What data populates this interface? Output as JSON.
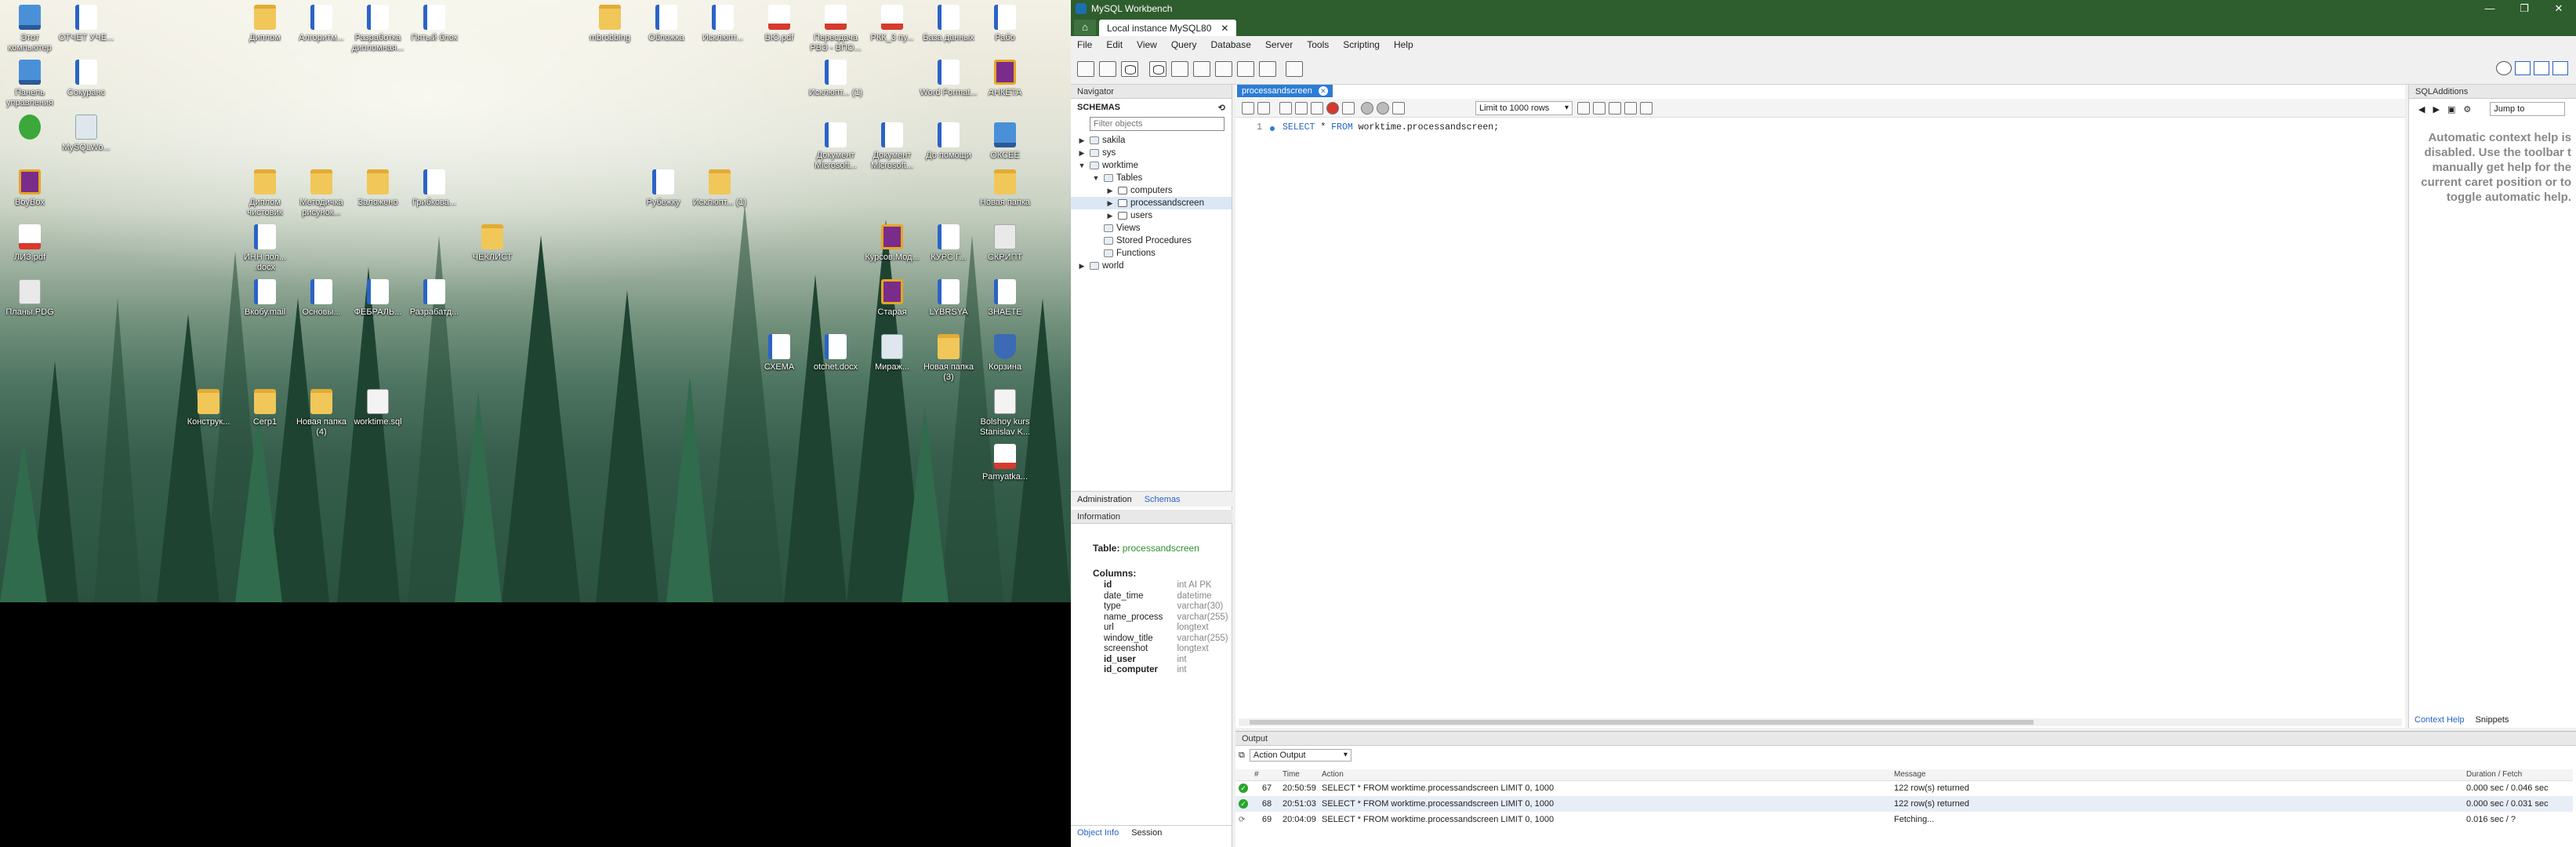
{
  "desktop": {
    "icons": [
      {
        "label": "Этот компьютер",
        "kind": "pc"
      },
      {
        "label": "ОТЧЕТ УЧЕ...",
        "kind": "doc"
      },
      {
        "label": "Диплом",
        "kind": "folder"
      },
      {
        "label": "Алгоритм...",
        "kind": "doc"
      },
      {
        "label": "Разработка дипломная...",
        "kind": "doc"
      },
      {
        "label": "Пятый блок",
        "kind": "doc"
      },
      {
        "label": "mbrobbing",
        "kind": "folder"
      },
      {
        "label": "Обложка",
        "kind": "doc"
      },
      {
        "label": "Исклюпт...",
        "kind": "doc"
      },
      {
        "label": "БЮ.pdf",
        "kind": "pdf"
      },
      {
        "label": "Пересдача РВЭ - ВПО...",
        "kind": "pdf"
      },
      {
        "label": "РКК_3 пу...",
        "kind": "pdf"
      },
      {
        "label": "База данных",
        "kind": "doc"
      },
      {
        "label": "Рабо",
        "kind": "doc"
      },
      {
        "label": "Панель управления",
        "kind": "pc"
      },
      {
        "label": "Сокуранс",
        "kind": "doc"
      },
      {
        "label": "Исклюпт... (1)",
        "kind": "doc"
      },
      {
        "label": "Word Format...",
        "kind": "doc"
      },
      {
        "label": "АНКЕТА",
        "kind": "rar"
      },
      {
        "label": "",
        "kind": "app"
      },
      {
        "label": "MySQLWo...",
        "kind": "bin"
      },
      {
        "label": "Документ Microsoft...",
        "kind": "doc"
      },
      {
        "label": "Документ Microsoft...",
        "kind": "doc"
      },
      {
        "label": "До помощи",
        "kind": "doc"
      },
      {
        "label": "ОКСЕЕ",
        "kind": "pc"
      },
      {
        "label": "BoyBox",
        "kind": "rar"
      },
      {
        "label": "Диплом чистовик",
        "kind": "folder"
      },
      {
        "label": "Методичка рисунок...",
        "kind": "folder"
      },
      {
        "label": "Заложено",
        "kind": "folder"
      },
      {
        "label": "Грибкова...",
        "kind": "doc"
      },
      {
        "label": "Рубежку",
        "kind": "doc"
      },
      {
        "label": "Исклюпт... (1)",
        "kind": "folder"
      },
      {
        "label": "Новая папка",
        "kind": "folder"
      },
      {
        "label": "ЛИЗ.pdf",
        "kind": "pdf"
      },
      {
        "label": "ИНН пол... .docx",
        "kind": "doc"
      },
      {
        "label": "ЧЕКЛИСТ",
        "kind": "folder"
      },
      {
        "label": "Курсов.Мод...",
        "kind": "rar"
      },
      {
        "label": "КУРС Г...",
        "kind": "doc"
      },
      {
        "label": "СКРИПТ",
        "kind": "blank"
      },
      {
        "label": "Планы.PDG",
        "kind": "blank"
      },
      {
        "label": "Вкобу.mail",
        "kind": "doc"
      },
      {
        "label": "Основы...",
        "kind": "doc"
      },
      {
        "label": "ФЕБРАЛЬ...",
        "kind": "doc"
      },
      {
        "label": "Разрабатд...",
        "kind": "doc"
      },
      {
        "label": "Старая",
        "kind": "rar"
      },
      {
        "label": "LYBRSYA",
        "kind": "doc"
      },
      {
        "label": "ЗНАЕТЕ",
        "kind": "doc"
      },
      {
        "label": "СХЕМА",
        "kind": "doc"
      },
      {
        "label": "otchet.docx",
        "kind": "doc"
      },
      {
        "label": "Мираж...",
        "kind": "bin"
      },
      {
        "label": "Новая папка (3)",
        "kind": "folder"
      },
      {
        "label": "Корзина",
        "kind": "shield"
      },
      {
        "label": "Конструк...",
        "kind": "folder"
      },
      {
        "label": "Сегр1",
        "kind": "folder"
      },
      {
        "label": "Новая папка (4)",
        "kind": "folder"
      },
      {
        "label": "worktime.sql",
        "kind": "txt"
      },
      {
        "label": "Bolshoy kurs Stanislav K...",
        "kind": "txt"
      },
      {
        "label": "Pamyatka...",
        "kind": "pdf"
      }
    ]
  },
  "wb": {
    "title": "MySQL Workbench",
    "winbtns": [
      "—",
      "❐",
      "✕"
    ],
    "home_icon": "home-icon",
    "conn_tab": "Local instance MySQL80",
    "conn_close": "✕",
    "menu": [
      "File",
      "Edit",
      "View",
      "Query",
      "Database",
      "Server",
      "Tools",
      "Scripting",
      "Help"
    ],
    "navigator": {
      "header": "Navigator",
      "schemas": "SCHEMAS",
      "filter_placeholder": "Filter objects",
      "tree": [
        {
          "label": "sakila",
          "depth": 0,
          "arrow": "▶",
          "icon": "db"
        },
        {
          "label": "sys",
          "depth": 0,
          "arrow": "▶",
          "icon": "db"
        },
        {
          "label": "worktime",
          "depth": 0,
          "arrow": "▼",
          "icon": "db"
        },
        {
          "label": "Tables",
          "depth": 1,
          "arrow": "▼",
          "icon": "db"
        },
        {
          "label": "computers",
          "depth": 2,
          "arrow": "▶",
          "icon": "tbl"
        },
        {
          "label": "processandscreen",
          "depth": 2,
          "arrow": "▶",
          "icon": "tbl",
          "selected": true
        },
        {
          "label": "users",
          "depth": 2,
          "arrow": "▶",
          "icon": "tbl"
        },
        {
          "label": "Views",
          "depth": 1,
          "arrow": "",
          "icon": "db"
        },
        {
          "label": "Stored Procedures",
          "depth": 1,
          "arrow": "",
          "icon": "db"
        },
        {
          "label": "Functions",
          "depth": 1,
          "arrow": "",
          "icon": "db"
        },
        {
          "label": "world",
          "depth": 0,
          "arrow": "▶",
          "icon": "db"
        }
      ],
      "tab_admin": "Administration",
      "tab_schemas": "Schemas",
      "info_header": "Information",
      "table_label": "Table:",
      "table_name": "processandscreen",
      "columns_label": "Columns:",
      "columns": [
        {
          "name": "id",
          "type": "int AI PK",
          "bold": true
        },
        {
          "name": "date_time",
          "type": "datetime",
          "bold": false
        },
        {
          "name": "type",
          "type": "varchar(30)",
          "bold": false
        },
        {
          "name": "name_process",
          "type": "varchar(255)",
          "bold": false
        },
        {
          "name": "url",
          "type": "longtext",
          "bold": false
        },
        {
          "name": "window_title",
          "type": "varchar(255)",
          "bold": false
        },
        {
          "name": "screenshot",
          "type": "longtext",
          "bold": false
        },
        {
          "name": "id_user",
          "type": "int",
          "bold": true
        },
        {
          "name": "id_computer",
          "type": "int",
          "bold": true
        }
      ],
      "tab_objinfo": "Object Info",
      "tab_session": "Session"
    },
    "editor": {
      "tab": "processandscreen",
      "limit": "Limit to 1000 rows",
      "line_no": "1",
      "sql_kw1": "SELECT",
      "sql_star": " * ",
      "sql_kw2": "FROM",
      "sql_rest": " worktime.processandscreen;"
    },
    "additions": {
      "header": "SQLAdditions",
      "jump": "Jump to",
      "help": "Automatic context help is disabled. Use the toolbar t manually get help for the current caret position or to toggle automatic help.",
      "tab_context": "Context Help",
      "tab_snippets": "Snippets"
    },
    "output": {
      "header": "Output",
      "selector": "Action Output",
      "cols": [
        "#",
        "Time",
        "Action",
        "Message",
        "Duration / Fetch"
      ],
      "rows": [
        {
          "status": "ok",
          "n": "67",
          "time": "20:50:59",
          "action": "SELECT * FROM worktime.processandscreen LIMIT 0, 1000",
          "message": "122 row(s) returned",
          "duration": "0.000 sec / 0.046 sec"
        },
        {
          "status": "ok",
          "n": "68",
          "time": "20:51:03",
          "action": "SELECT * FROM worktime.processandscreen LIMIT 0, 1000",
          "message": "122 row(s) returned",
          "duration": "0.000 sec / 0.031 sec"
        },
        {
          "status": "pending",
          "n": "69",
          "time": "20:04:09",
          "action": "SELECT * FROM worktime.processandscreen LIMIT 0, 1000",
          "message": "Fetching...",
          "duration": "0.016 sec / ?"
        }
      ]
    }
  }
}
